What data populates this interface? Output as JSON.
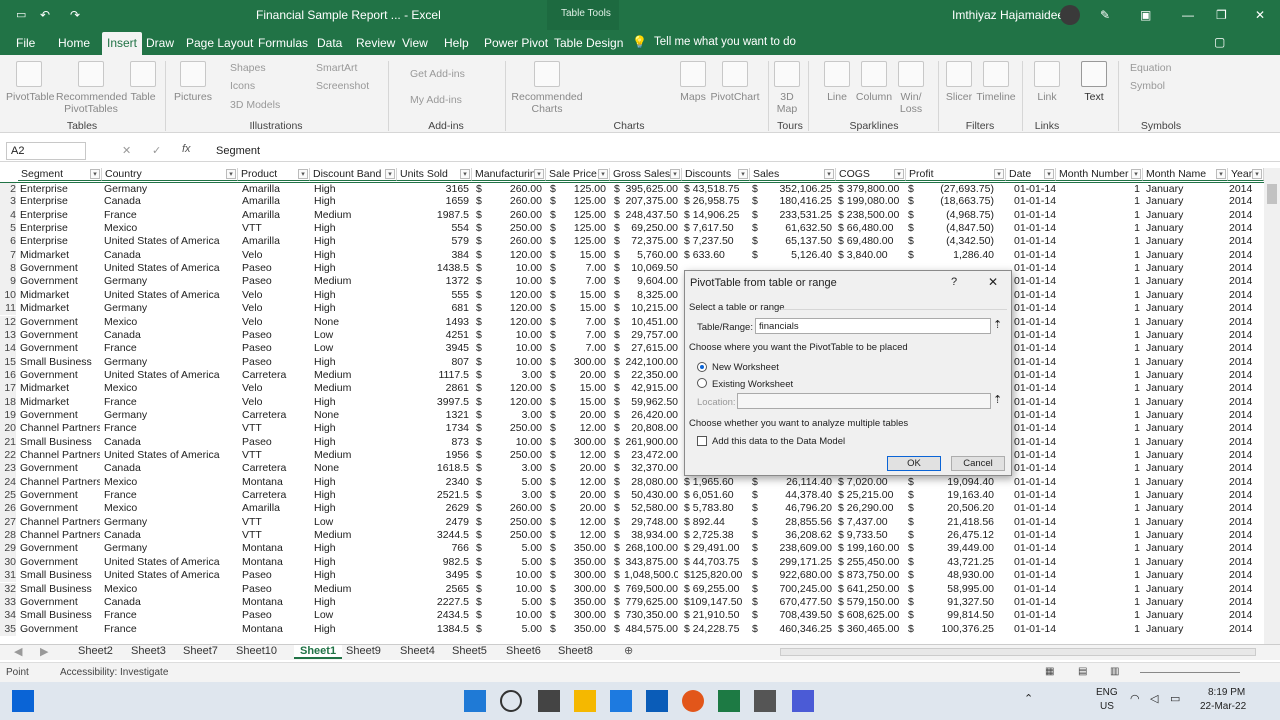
{
  "window": {
    "doc_title": "Financial Sample Report ... - Excel",
    "context_tab": "Table Tools",
    "user": "Imthiyaz Hajamaideen"
  },
  "tabs": [
    "File",
    "Home",
    "Insert",
    "Draw",
    "Page Layout",
    "Formulas",
    "Data",
    "Review",
    "View",
    "Help",
    "Power Pivot",
    "Table Design"
  ],
  "tell_me": "Tell me what you want to do",
  "ribbon": {
    "items": [
      "PivotTable",
      "Recommended PivotTables",
      "Table",
      "Pictures",
      "Shapes",
      "Icons",
      "3D Models",
      "SmartArt",
      "Screenshot",
      "Get Add-ins",
      "My Add-ins",
      "Recommended Charts",
      "Maps",
      "PivotChart",
      "3D Map",
      "Line",
      "Column",
      "Win/ Loss",
      "Slicer",
      "Timeline",
      "Link",
      "Text",
      "Equation",
      "Symbol"
    ],
    "groups": [
      "Tables",
      "Illustrations",
      "Add-ins",
      "Charts",
      "Tours",
      "Sparklines",
      "Filters",
      "Links",
      "Symbols"
    ]
  },
  "formula": {
    "namebox": "A2",
    "fx": "fx",
    "value": "Segment"
  },
  "columns": [
    "Segment",
    "Country",
    "Product",
    "Discount Band",
    "Units Sold",
    "Manufacturing",
    "Sale Price",
    "Gross Sales",
    "Discounts",
    "Sales",
    "COGS",
    "Profit",
    "Date",
    "Month Number",
    "Month Name",
    "Year"
  ],
  "rows": [
    [
      "2",
      "Enterprise",
      "Germany",
      "Amarilla",
      "High",
      "3165",
      "$",
      "260.00",
      "$",
      "125.00",
      "$",
      "395,625.00",
      "$ 43,518.75",
      "$",
      "352,106.25",
      "$ 379,800.00",
      "$",
      "(27,693.75)",
      "01-01-14",
      "1",
      "January",
      "2014"
    ],
    [
      "3",
      "Enterprise",
      "Canada",
      "Amarilla",
      "High",
      "1659",
      "$",
      "260.00",
      "$",
      "125.00",
      "$",
      "207,375.00",
      "$ 26,958.75",
      "$",
      "180,416.25",
      "$ 199,080.00",
      "$",
      "(18,663.75)",
      "01-01-14",
      "1",
      "January",
      "2014"
    ],
    [
      "4",
      "Enterprise",
      "France",
      "Amarilla",
      "Medium",
      "1987.5",
      "$",
      "260.00",
      "$",
      "125.00",
      "$",
      "248,437.50",
      "$ 14,906.25",
      "$",
      "233,531.25",
      "$ 238,500.00",
      "$",
      "(4,968.75)",
      "01-01-14",
      "1",
      "January",
      "2014"
    ],
    [
      "5",
      "Enterprise",
      "Mexico",
      "VTT",
      "High",
      "554",
      "$",
      "250.00",
      "$",
      "125.00",
      "$",
      "69,250.00",
      "$ 7,617.50",
      "$",
      "61,632.50",
      "$ 66,480.00",
      "$",
      "(4,847.50)",
      "01-01-14",
      "1",
      "January",
      "2014"
    ],
    [
      "6",
      "Enterprise",
      "United States of America",
      "Amarilla",
      "High",
      "579",
      "$",
      "260.00",
      "$",
      "125.00",
      "$",
      "72,375.00",
      "$ 7,237.50",
      "$",
      "65,137.50",
      "$ 69,480.00",
      "$",
      "(4,342.50)",
      "01-01-14",
      "1",
      "January",
      "2014"
    ],
    [
      "7",
      "Midmarket",
      "Canada",
      "Velo",
      "High",
      "384",
      "$",
      "120.00",
      "$",
      "15.00",
      "$",
      "5,760.00",
      "$ 633.60",
      "$",
      "5,126.40",
      "$ 3,840.00",
      "$",
      "1,286.40",
      "01-01-14",
      "1",
      "January",
      "2014"
    ],
    [
      "8",
      "Government",
      "United States of America",
      "Paseo",
      "High",
      "1438.5",
      "$",
      "10.00",
      "$",
      "7.00",
      "$",
      "10,069.50",
      "",
      "",
      "",
      "",
      "",
      "",
      "01-01-14",
      "1",
      "January",
      "2014"
    ],
    [
      "9",
      "Government",
      "Germany",
      "Paseo",
      "Medium",
      "1372",
      "$",
      "10.00",
      "$",
      "7.00",
      "$",
      "9,604.00",
      "",
      "",
      "",
      "",
      "",
      "",
      "01-01-14",
      "1",
      "January",
      "2014"
    ],
    [
      "10",
      "Midmarket",
      "United States of America",
      "Velo",
      "High",
      "555",
      "$",
      "120.00",
      "$",
      "15.00",
      "$",
      "8,325.00",
      "",
      "",
      "",
      "",
      "",
      "",
      "01-01-14",
      "1",
      "January",
      "2014"
    ],
    [
      "11",
      "Midmarket",
      "Germany",
      "Velo",
      "High",
      "681",
      "$",
      "120.00",
      "$",
      "15.00",
      "$",
      "10,215.00",
      "",
      "",
      "",
      "",
      "",
      "",
      "01-01-14",
      "1",
      "January",
      "2014"
    ],
    [
      "12",
      "Government",
      "Mexico",
      "Velo",
      "None",
      "1493",
      "$",
      "120.00",
      "$",
      "7.00",
      "$",
      "10,451.00",
      "",
      "",
      "",
      "",
      "",
      "",
      "01-01-14",
      "1",
      "January",
      "2014"
    ],
    [
      "13",
      "Government",
      "Canada",
      "Paseo",
      "Low",
      "4251",
      "$",
      "10.00",
      "$",
      "7.00",
      "$",
      "29,757.00",
      "",
      "",
      "",
      "",
      "",
      "",
      "01-01-14",
      "1",
      "January",
      "2014"
    ],
    [
      "14",
      "Government",
      "France",
      "Paseo",
      "Low",
      "3945",
      "$",
      "10.00",
      "$",
      "7.00",
      "$",
      "27,615.00",
      "",
      "",
      "",
      "",
      "",
      "",
      "01-01-14",
      "1",
      "January",
      "2014"
    ],
    [
      "15",
      "Small Business",
      "Germany",
      "Paseo",
      "High",
      "807",
      "$",
      "10.00",
      "$",
      "300.00",
      "$",
      "242,100.00",
      "",
      "",
      "",
      "",
      "",
      "",
      "01-01-14",
      "1",
      "January",
      "2014"
    ],
    [
      "16",
      "Government",
      "United States of America",
      "Carretera",
      "Medium",
      "1117.5",
      "$",
      "3.00",
      "$",
      "20.00",
      "$",
      "22,350.00",
      "",
      "",
      "",
      "",
      "",
      "",
      "01-01-14",
      "1",
      "January",
      "2014"
    ],
    [
      "17",
      "Midmarket",
      "Mexico",
      "Velo",
      "Medium",
      "2861",
      "$",
      "120.00",
      "$",
      "15.00",
      "$",
      "42,915.00",
      "",
      "",
      "",
      "",
      "",
      "",
      "01-01-14",
      "1",
      "January",
      "2014"
    ],
    [
      "18",
      "Midmarket",
      "France",
      "Velo",
      "High",
      "3997.5",
      "$",
      "120.00",
      "$",
      "15.00",
      "$",
      "59,962.50",
      "",
      "",
      "",
      "",
      "",
      "",
      "01-01-14",
      "1",
      "January",
      "2014"
    ],
    [
      "19",
      "Government",
      "Germany",
      "Carretera",
      "None",
      "1321",
      "$",
      "3.00",
      "$",
      "20.00",
      "$",
      "26,420.00",
      "",
      "",
      "",
      "",
      "",
      "",
      "01-01-14",
      "1",
      "January",
      "2014"
    ],
    [
      "20",
      "Channel Partners",
      "France",
      "VTT",
      "High",
      "1734",
      "$",
      "250.00",
      "$",
      "12.00",
      "$",
      "20,808.00",
      "",
      "",
      "",
      "",
      "",
      "",
      "01-01-14",
      "1",
      "January",
      "2014"
    ],
    [
      "21",
      "Small Business",
      "Canada",
      "Paseo",
      "High",
      "873",
      "$",
      "10.00",
      "$",
      "300.00",
      "$",
      "261,900.00",
      "",
      "",
      "",
      "",
      "",
      "",
      "01-01-14",
      "1",
      "January",
      "2014"
    ],
    [
      "22",
      "Channel Partners",
      "United States of America",
      "VTT",
      "Medium",
      "1956",
      "$",
      "250.00",
      "$",
      "12.00",
      "$",
      "23,472.00",
      "",
      "",
      "",
      "",
      "",
      "",
      "01-01-14",
      "1",
      "January",
      "2014"
    ],
    [
      "23",
      "Government",
      "Canada",
      "Carretera",
      "None",
      "1618.5",
      "$",
      "3.00",
      "$",
      "20.00",
      "$",
      "32,370.00",
      "",
      "",
      "",
      "",
      "",
      "",
      "01-01-14",
      "1",
      "January",
      "2014"
    ],
    [
      "24",
      "Channel Partners",
      "Mexico",
      "Montana",
      "High",
      "2340",
      "$",
      "5.00",
      "$",
      "12.00",
      "$",
      "28,080.00",
      "$ 1,965.60",
      "$",
      "26,114.40",
      "$ 7,020.00",
      "$",
      "19,094.40",
      "01-01-14",
      "1",
      "January",
      "2014"
    ],
    [
      "25",
      "Government",
      "France",
      "Carretera",
      "High",
      "2521.5",
      "$",
      "3.00",
      "$",
      "20.00",
      "$",
      "50,430.00",
      "$ 6,051.60",
      "$",
      "44,378.40",
      "$ 25,215.00",
      "$",
      "19,163.40",
      "01-01-14",
      "1",
      "January",
      "2014"
    ],
    [
      "26",
      "Government",
      "Mexico",
      "Amarilla",
      "High",
      "2629",
      "$",
      "260.00",
      "$",
      "20.00",
      "$",
      "52,580.00",
      "$ 5,783.80",
      "$",
      "46,796.20",
      "$ 26,290.00",
      "$",
      "20,506.20",
      "01-01-14",
      "1",
      "January",
      "2014"
    ],
    [
      "27",
      "Channel Partners",
      "Germany",
      "VTT",
      "Low",
      "2479",
      "$",
      "250.00",
      "$",
      "12.00",
      "$",
      "29,748.00",
      "$ 892.44",
      "$",
      "28,855.56",
      "$ 7,437.00",
      "$",
      "21,418.56",
      "01-01-14",
      "1",
      "January",
      "2014"
    ],
    [
      "28",
      "Channel Partners",
      "Canada",
      "VTT",
      "Medium",
      "3244.5",
      "$",
      "250.00",
      "$",
      "12.00",
      "$",
      "38,934.00",
      "$ 2,725.38",
      "$",
      "36,208.62",
      "$ 9,733.50",
      "$",
      "26,475.12",
      "01-01-14",
      "1",
      "January",
      "2014"
    ],
    [
      "29",
      "Government",
      "Germany",
      "Montana",
      "High",
      "766",
      "$",
      "5.00",
      "$",
      "350.00",
      "$",
      "268,100.00",
      "$ 29,491.00",
      "$",
      "238,609.00",
      "$ 199,160.00",
      "$",
      "39,449.00",
      "01-01-14",
      "1",
      "January",
      "2014"
    ],
    [
      "30",
      "Government",
      "United States of America",
      "Montana",
      "High",
      "982.5",
      "$",
      "5.00",
      "$",
      "350.00",
      "$",
      "343,875.00",
      "$ 44,703.75",
      "$",
      "299,171.25",
      "$ 255,450.00",
      "$",
      "43,721.25",
      "01-01-14",
      "1",
      "January",
      "2014"
    ],
    [
      "31",
      "Small Business",
      "United States of America",
      "Paseo",
      "High",
      "3495",
      "$",
      "10.00",
      "$",
      "300.00",
      "$",
      "1,048,500.00",
      "$125,820.00",
      "$",
      "922,680.00",
      "$ 873,750.00",
      "$",
      "48,930.00",
      "01-01-14",
      "1",
      "January",
      "2014"
    ],
    [
      "32",
      "Small Business",
      "Mexico",
      "Paseo",
      "Medium",
      "2565",
      "$",
      "10.00",
      "$",
      "300.00",
      "$",
      "769,500.00",
      "$ 69,255.00",
      "$",
      "700,245.00",
      "$ 641,250.00",
      "$",
      "58,995.00",
      "01-01-14",
      "1",
      "January",
      "2014"
    ],
    [
      "33",
      "Government",
      "Canada",
      "Montana",
      "High",
      "2227.5",
      "$",
      "5.00",
      "$",
      "350.00",
      "$",
      "779,625.00",
      "$109,147.50",
      "$",
      "670,477.50",
      "$ 579,150.00",
      "$",
      "91,327.50",
      "01-01-14",
      "1",
      "January",
      "2014"
    ],
    [
      "34",
      "Small Business",
      "France",
      "Paseo",
      "Low",
      "2434.5",
      "$",
      "10.00",
      "$",
      "300.00",
      "$",
      "730,350.00",
      "$ 21,910.50",
      "$",
      "708,439.50",
      "$ 608,625.00",
      "$",
      "99,814.50",
      "01-01-14",
      "1",
      "January",
      "2014"
    ],
    [
      "35",
      "Government",
      "France",
      "Montana",
      "High",
      "1384.5",
      "$",
      "5.00",
      "$",
      "350.00",
      "$",
      "484,575.00",
      "$ 24,228.75",
      "$",
      "460,346.25",
      "$ 360,465.00",
      "$",
      "100,376.25",
      "01-01-14",
      "1",
      "January",
      "2014"
    ]
  ],
  "sheets": [
    "Sheet2",
    "Sheet3",
    "Sheet7",
    "Sheet10",
    "Sheet1",
    "Sheet9",
    "Sheet4",
    "Sheet5",
    "Sheet6",
    "Sheet8"
  ],
  "active_sheet": "Sheet1",
  "status": {
    "mode": "Point",
    "accessibility": "Accessibility: Investigate"
  },
  "taskbar": {
    "lang": "ENG",
    "region": "US",
    "time": "8:19 PM",
    "date": "22-Mar-22"
  },
  "dialog": {
    "title": "PivotTable from table or range",
    "select_label": "Select a table or range",
    "table_range_label": "Table/Range:",
    "table_range_value": "financials",
    "placement_label": "Choose where you want the PivotTable to be placed",
    "new_ws": "New Worksheet",
    "existing_ws": "Existing Worksheet",
    "location_label": "Location:",
    "multi_label": "Choose whether you want to analyze multiple tables",
    "add_model": "Add this data to the Data Model",
    "ok": "OK",
    "cancel": "Cancel",
    "help": "?",
    "close": "✕"
  }
}
